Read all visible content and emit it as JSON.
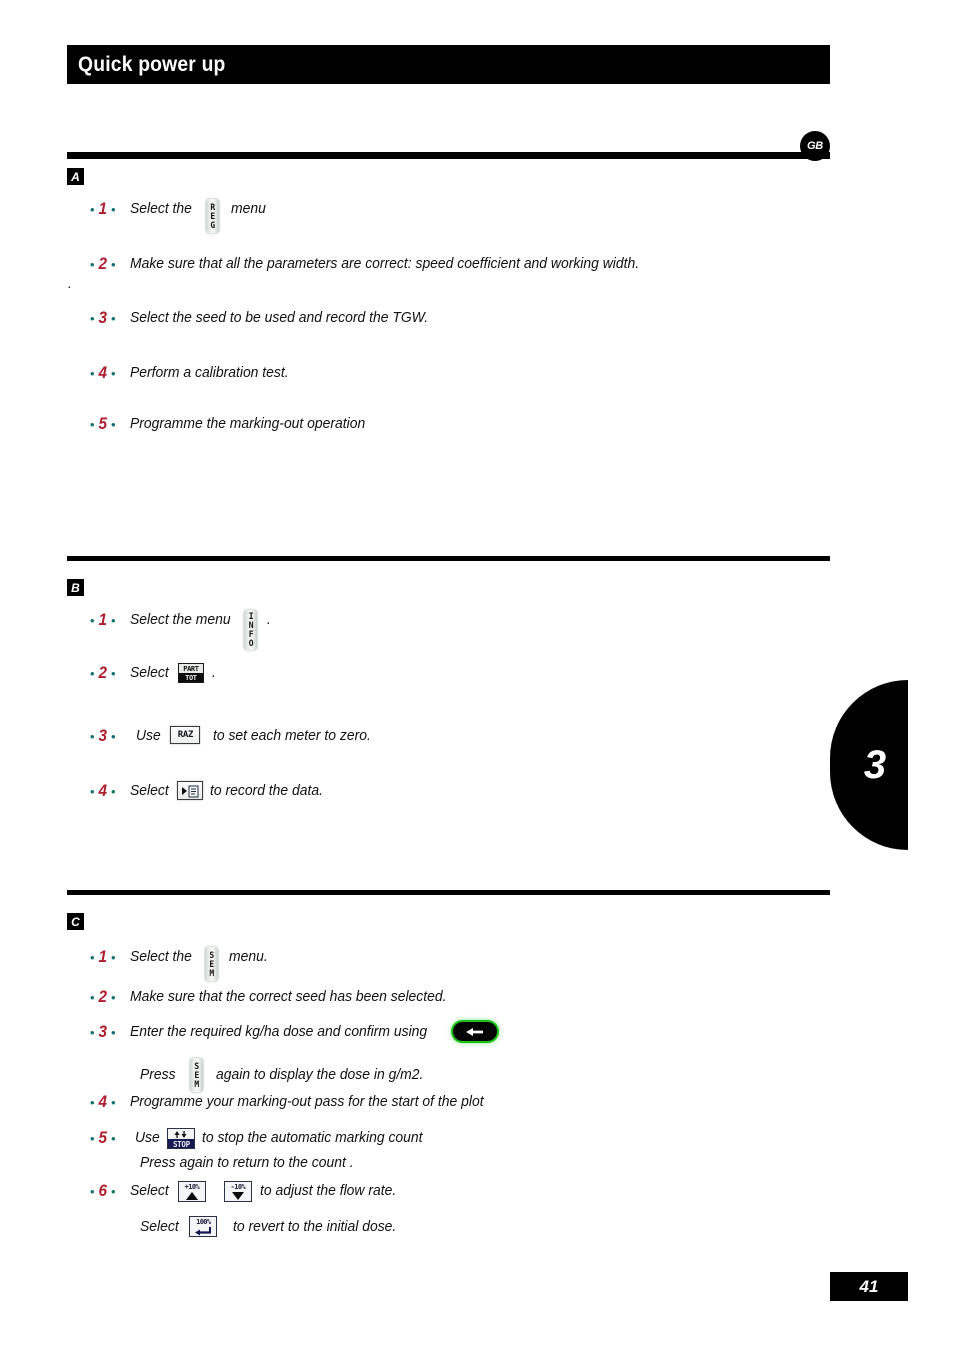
{
  "document": {
    "title": "Quick power up",
    "language_badge": "GB",
    "chapter_tab": "3",
    "page_number": "41",
    "stray_mark": "."
  },
  "sections": [
    {
      "letter": "A",
      "items": [
        {
          "number": "1",
          "text_before": "Select the",
          "icon": "reg-key",
          "icon_letters": [
            "R",
            "E",
            "G"
          ],
          "text_after": "menu"
        },
        {
          "number": "2",
          "text_before": "Make sure that all the parameters are correct: speed coefficient and working width.",
          "icon": null,
          "text_after": ""
        },
        {
          "number": "3",
          "text_before": "Select the seed to be used and record the TGW.",
          "icon": null,
          "text_after": ""
        },
        {
          "number": "4",
          "text_before": "Perform a calibration test.",
          "icon": null,
          "text_after": ""
        },
        {
          "number": "5",
          "text_before": "Programme the marking-out operation",
          "icon": null,
          "text_after": ""
        }
      ]
    },
    {
      "letter": "B",
      "items": [
        {
          "number": "1",
          "text_before": "Select the menu",
          "icon": "info-key",
          "icon_letters": [
            "I",
            "N",
            "F",
            "O"
          ],
          "text_after": "."
        },
        {
          "number": "2",
          "text_before": "Select",
          "icon": "part-tot-key",
          "icon_top": "PART",
          "icon_bottom": "TOT",
          "text_after": "."
        },
        {
          "number": "3",
          "text_before": "Use",
          "icon": "raz-key",
          "icon_label": "RAZ",
          "text_after": "to set each meter to zero."
        },
        {
          "number": "4",
          "text_before": "Select",
          "icon": "record-key",
          "text_after": "to record the data."
        }
      ]
    },
    {
      "letter": "C",
      "items": [
        {
          "number": "1",
          "text_before": "Select the",
          "icon": "sem-key",
          "icon_letters": [
            "S",
            "E",
            "M"
          ],
          "text_after": "menu."
        },
        {
          "number": "2",
          "text_before": "Make sure that the correct seed has been selected.",
          "icon": null,
          "text_after": ""
        },
        {
          "number": "3",
          "text_before": "Enter the required kg/ha dose and confirm using",
          "icon": "enter-key",
          "text_after": ""
        },
        {
          "number": "4",
          "text_before": "Programme your marking-out pass for the start of the plot",
          "icon": null,
          "text_after": ""
        },
        {
          "number": "5",
          "text_before": "Use",
          "icon": "stop-key",
          "icon_label": "STOP",
          "text_after": "to stop the automatic marking count"
        },
        {
          "number": "6",
          "text_before": "Select",
          "icon": "plus-10-key",
          "icon2": "minus-10-key",
          "icon_label": "+10%",
          "icon2_label": "-10%",
          "text_after": "to adjust the flow rate."
        }
      ],
      "sublines": [
        {
          "text_before": "Press",
          "icon": "sem-key",
          "icon_letters": [
            "S",
            "E",
            "M"
          ],
          "text_after": "again to display the dose in g/m2."
        },
        {
          "text_before": "Press again to return to the count .",
          "icon": null,
          "text_after": ""
        },
        {
          "text_before": "Select",
          "icon": "hundred-percent-key",
          "icon_label": "100%",
          "text_after": "to revert to the initial dose."
        }
      ]
    }
  ],
  "colors": {
    "bullet_teal": "#13706e",
    "number_red": "#ad1f2e",
    "bar_black": "#000000",
    "enter_glow_green": "#18c117",
    "stop_navy": "#161a52"
  }
}
